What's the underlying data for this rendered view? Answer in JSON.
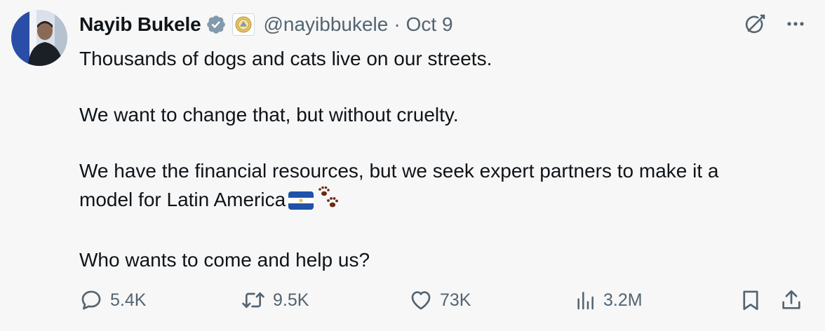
{
  "author": {
    "name": "Nayib Bukele",
    "handle": "@nayibbukele",
    "separator": "·",
    "date": "Oct 9",
    "verified_color": "#829aab"
  },
  "tweet": {
    "lines": [
      "Thousands of dogs and cats live on our streets.",
      "We want to change that, but without cruelty.",
      "We have the financial resources, but we seek expert partners to make it a",
      "model for Latin America",
      "Who wants to come and help us?"
    ]
  },
  "actions": {
    "replies": "5.4K",
    "retweets": "9.5K",
    "likes": "73K",
    "views": "3.2M"
  },
  "icons": {
    "verified": "verified-badge-icon",
    "affiliate": "government-seal-icon",
    "grok": "grok-icon",
    "more": "more-icon",
    "reply": "reply-icon",
    "retweet": "retweet-icon",
    "like": "heart-icon",
    "views": "views-icon",
    "bookmark": "bookmark-icon",
    "share": "share-icon",
    "flag": "el-salvador-flag-icon",
    "paws": "paw-prints-icon"
  },
  "colors": {
    "background": "#f7f7f7",
    "text": "#0f1419",
    "secondary": "#536471"
  }
}
